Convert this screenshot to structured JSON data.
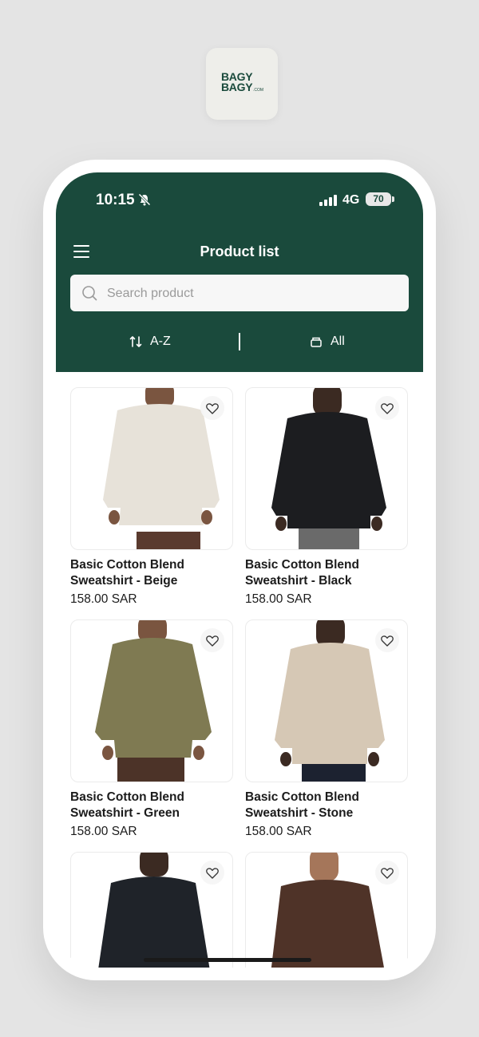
{
  "brand": {
    "logo_line1": "BAGY",
    "logo_line2": "BAGY",
    "logo_suffix": ".COM",
    "color": "#1a4a3c"
  },
  "status_bar": {
    "time": "10:15",
    "network": "4G",
    "battery": "70"
  },
  "header": {
    "title": "Product list"
  },
  "search": {
    "placeholder": "Search product",
    "value": ""
  },
  "controls": {
    "sort_label": "A-Z",
    "filter_label": "All"
  },
  "products": [
    {
      "name": "Basic Cotton Blend Sweatshirt - Beige",
      "price": "158.00 SAR",
      "color": "#e7e2d9"
    },
    {
      "name": "Basic Cotton Blend Sweatshirt - Black",
      "price": "158.00 SAR",
      "color": "#1c1d20"
    },
    {
      "name": "Basic Cotton Blend Sweatshirt - Green",
      "price": "158.00 SAR",
      "color": "#7f7a52"
    },
    {
      "name": "Basic Cotton Blend Sweatshirt - Stone",
      "price": "158.00 SAR",
      "color": "#d6c8b5"
    },
    {
      "name": "",
      "price": "",
      "color": "#1f2329"
    },
    {
      "name": "",
      "price": "",
      "color": "#4f3328"
    }
  ]
}
